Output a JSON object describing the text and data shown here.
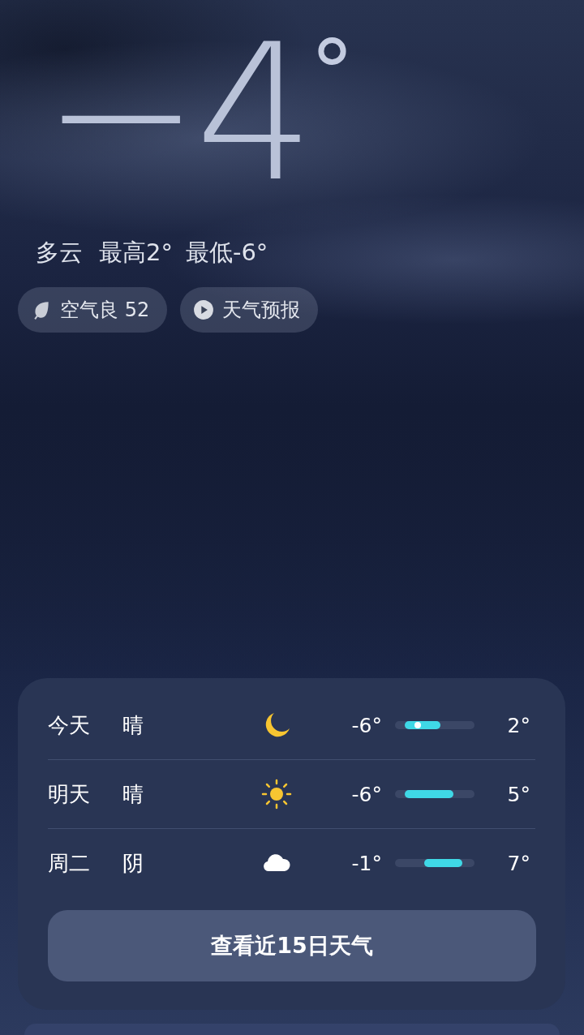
{
  "current": {
    "temperature": "−4",
    "degree": "°",
    "summary": [
      {
        "text": "多云"
      },
      {
        "text": "最高2°"
      },
      {
        "text": "最低-6°"
      }
    ]
  },
  "chips": [
    {
      "kind": "leaf",
      "label": "空气良 52"
    },
    {
      "kind": "play",
      "label": "天气预报"
    }
  ],
  "forecast": [
    {
      "day": "今天",
      "condition": "晴",
      "kind": "moon",
      "low": "-6°",
      "high": "2°",
      "bar_start": {
        "level": 0.17
      },
      "bar": {
        "level": 0.57
      },
      "current": {
        "level": 0.29
      }
    },
    {
      "day": "明天",
      "condition": "晴",
      "kind": "sun",
      "low": "-6°",
      "high": "5°",
      "bar_start": {
        "level": 0.17
      },
      "bar": {
        "level": 0.73
      }
    },
    {
      "day": "周二",
      "condition": "阴",
      "kind": "cloud",
      "low": "-1°",
      "high": "7°",
      "bar_start": {
        "level": 0.42
      },
      "bar": {
        "level": 0.85
      }
    }
  ],
  "more_button": "查看近15日天气"
}
